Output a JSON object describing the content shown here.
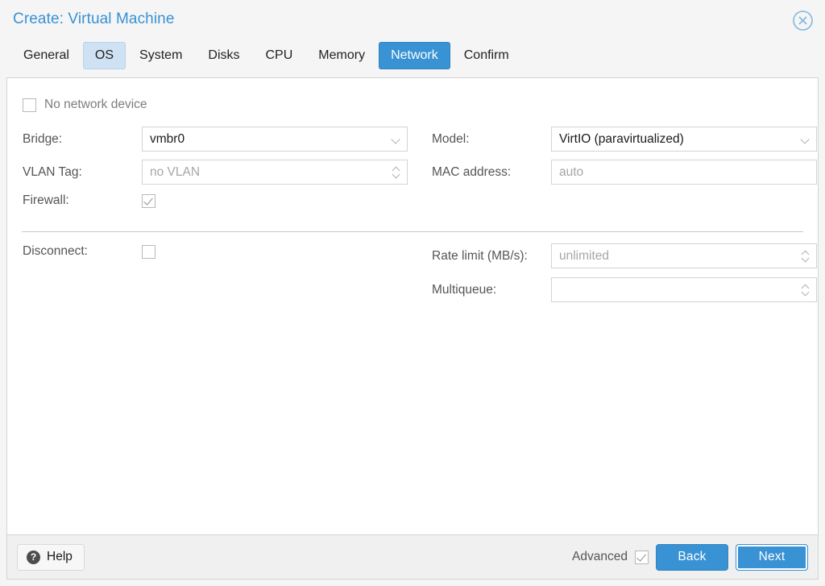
{
  "window": {
    "title": "Create: Virtual Machine",
    "close_icon": "close-circle-icon",
    "title_color": "#3892d4"
  },
  "tabs": [
    {
      "label": "General",
      "state": "normal"
    },
    {
      "label": "OS",
      "state": "visited"
    },
    {
      "label": "System",
      "state": "normal"
    },
    {
      "label": "Disks",
      "state": "normal"
    },
    {
      "label": "CPU",
      "state": "normal"
    },
    {
      "label": "Memory",
      "state": "normal"
    },
    {
      "label": "Network",
      "state": "active"
    },
    {
      "label": "Confirm",
      "state": "normal"
    }
  ],
  "form": {
    "no_network_device": {
      "label": "No network device",
      "checked": false
    },
    "bridge": {
      "label": "Bridge:",
      "value": "vmbr0",
      "icon": "chevron-down-icon"
    },
    "vlan_tag": {
      "label": "VLAN Tag:",
      "placeholder": "no VLAN",
      "value": "",
      "icon": "spinner-icon"
    },
    "firewall": {
      "label": "Firewall:",
      "checked": true
    },
    "model": {
      "label": "Model:",
      "value": "VirtIO (paravirtualized)",
      "icon": "chevron-down-icon"
    },
    "mac_address": {
      "label": "MAC address:",
      "placeholder": "auto",
      "value": ""
    },
    "disconnect": {
      "label": "Disconnect:",
      "checked": false
    },
    "rate_limit": {
      "label": "Rate limit (MB/s):",
      "placeholder": "unlimited",
      "value": "",
      "icon": "spinner-icon"
    },
    "multiqueue": {
      "label": "Multiqueue:",
      "placeholder": "",
      "value": "",
      "icon": "spinner-icon"
    }
  },
  "footer": {
    "help_label": "Help",
    "help_icon": "question-mark-icon",
    "advanced_label": "Advanced",
    "advanced_checked": true,
    "back_label": "Back",
    "next_label": "Next",
    "button_color": "#3892d4"
  }
}
